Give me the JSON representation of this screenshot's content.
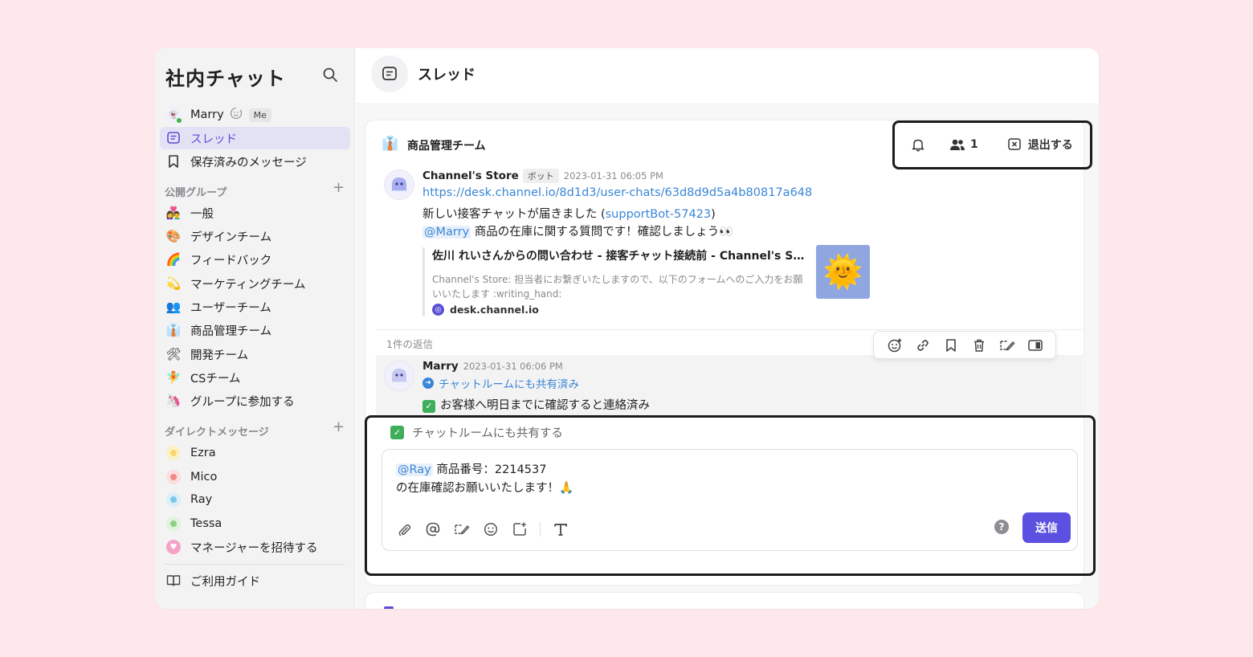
{
  "sidebar": {
    "title": "社内チャット",
    "user": {
      "name": "Marry",
      "badge": "Me"
    },
    "nav": [
      {
        "label": "スレッド",
        "icon": "thread-icon",
        "active": true
      },
      {
        "label": "保存済みのメッセージ",
        "icon": "bookmark-icon"
      }
    ],
    "public_groups_label": "公開グループ",
    "groups": [
      {
        "label": "一般",
        "emoji": "👩‍❤️‍👨"
      },
      {
        "label": "デザインチーム",
        "emoji": "🎨"
      },
      {
        "label": "フィードバック",
        "emoji": "🌈"
      },
      {
        "label": "マーケティングチーム",
        "emoji": "💫"
      },
      {
        "label": "ユーザーチーム",
        "emoji": "👥"
      },
      {
        "label": "商品管理チーム",
        "emoji": "👔"
      },
      {
        "label": "開発チーム",
        "emoji": "🛠"
      },
      {
        "label": "CSチーム",
        "emoji": "🧚"
      },
      {
        "label": "グループに参加する",
        "emoji": "🦄"
      }
    ],
    "dm_label": "ダイレクトメッセージ",
    "dms": [
      {
        "label": "Ezra",
        "color": "#f5d76e"
      },
      {
        "label": "Mico",
        "color": "#f08a8a"
      },
      {
        "label": "Ray",
        "color": "#7cc6e8"
      },
      {
        "label": "Tessa",
        "color": "#8fd18a"
      },
      {
        "label": "マネージャーを招待する",
        "color": "#f4a3c7"
      }
    ],
    "guide": "ご利用ガイド"
  },
  "header": {
    "title": "スレッド"
  },
  "thread": {
    "team": "商品管理チーム",
    "team_emoji": "👔",
    "members": "1",
    "leave": "退出する",
    "message": {
      "sender": "Channel's Store",
      "tag": "ボット",
      "time": "2023-01-31 06:05 PM",
      "url": "https://desk.channel.io/8d1d3/user-chats/63d8d9d5a4b80817a648",
      "line2_prefix": "新しい接客チャットが届きました (",
      "line2_link": "supportBot-57423",
      "line2_suffix": ")",
      "mention": "@Marry",
      "line3": " 商品の在庫に関する質問です！確認しましょう👀",
      "preview": {
        "title": "佐川 れいさんからの問い合わせ - 接客チャット接続前 - Channel's St...",
        "desc": "Channel's Store: 担当者にお繋ぎいたしますので、以下のフォームへのご入力をお願いいたします :writing_hand:",
        "site": "desk.channel.io",
        "thumb": "🌞"
      }
    },
    "reply_count": "1件の返信",
    "reply": {
      "sender": "Marry",
      "time": "2023-01-31 06:06 PM",
      "shared": "チャットルームにも共有済み",
      "text": "お客様へ明日までに確認すると連絡済み"
    },
    "composer": {
      "share_label": "チャットルームにも共有する",
      "mention": "@Ray",
      "line1": " 商品番号：2214537",
      "line2": "の在庫確認お願いいたします！🙏",
      "help": "?",
      "send": "送信"
    }
  },
  "colors": {
    "accent": "#5b50e0",
    "link": "#3a86d6",
    "highlight_border": "#1c1c1c",
    "background": "#fde9ec"
  }
}
